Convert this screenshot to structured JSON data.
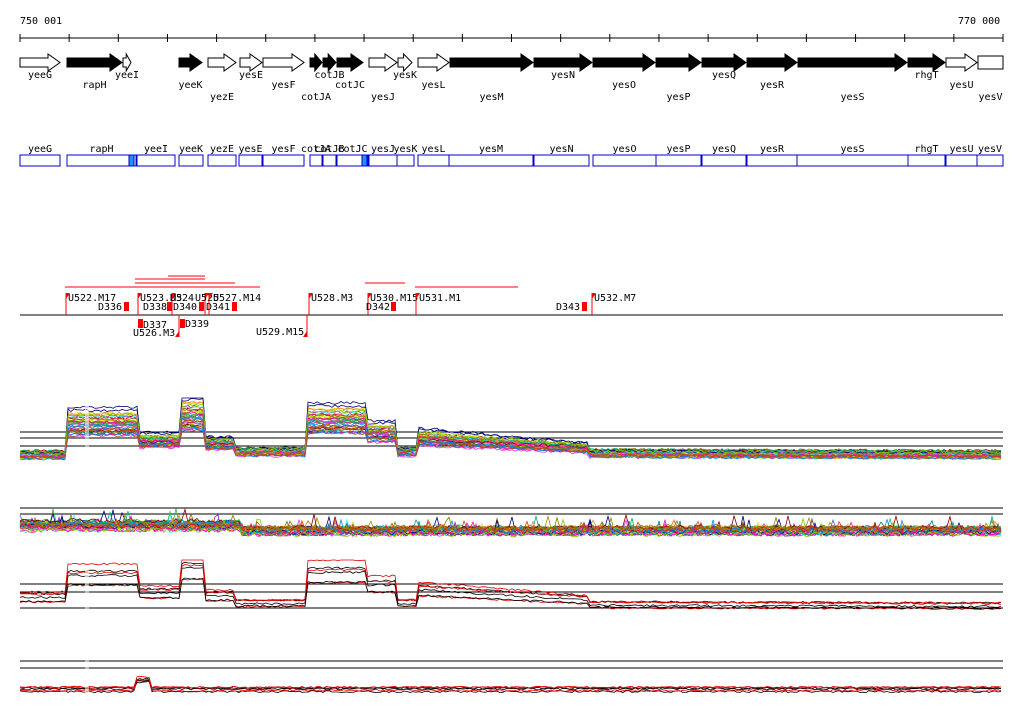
{
  "ruler": {
    "start_label": "750 001",
    "end_label": "770 000"
  },
  "genes": [
    {
      "name": "yeeG",
      "strand": "+",
      "fill": "white",
      "label_row": 1
    },
    {
      "name": "rapH",
      "strand": "+",
      "fill": "black",
      "label_row": 2
    },
    {
      "name": "yeeI",
      "strand": "+",
      "fill": "white",
      "label_row": 1
    },
    {
      "name": "yeeK",
      "strand": "+",
      "fill": "black",
      "label_row": 2
    },
    {
      "name": "yezE",
      "strand": "+",
      "fill": "white",
      "label_row": 3
    },
    {
      "name": "yesE",
      "strand": "+",
      "fill": "white",
      "label_row": 1
    },
    {
      "name": "yesF",
      "strand": "+",
      "fill": "white",
      "label_row": 2
    },
    {
      "name": "cotJA",
      "strand": "+",
      "fill": "black",
      "label_row": 3
    },
    {
      "name": "cotJB",
      "strand": "+",
      "fill": "black",
      "label_row": 1
    },
    {
      "name": "cotJC",
      "strand": "+",
      "fill": "black",
      "label_row": 2
    },
    {
      "name": "yesJ",
      "strand": "+",
      "fill": "white",
      "label_row": 3
    },
    {
      "name": "yesK",
      "strand": "+",
      "fill": "white",
      "label_row": 1
    },
    {
      "name": "yesL",
      "strand": "+",
      "fill": "white",
      "label_row": 2
    },
    {
      "name": "yesM",
      "strand": "+",
      "fill": "black",
      "label_row": 3
    },
    {
      "name": "yesN",
      "strand": "+",
      "fill": "black",
      "label_row": 1
    },
    {
      "name": "yesO",
      "strand": "+",
      "fill": "black",
      "label_row": 2
    },
    {
      "name": "yesP",
      "strand": "+",
      "fill": "black",
      "label_row": 3
    },
    {
      "name": "yesQ",
      "strand": "+",
      "fill": "black",
      "label_row": 1
    },
    {
      "name": "yesR",
      "strand": "+",
      "fill": "black",
      "label_row": 2
    },
    {
      "name": "yesS",
      "strand": "+",
      "fill": "black",
      "label_row": 3
    },
    {
      "name": "rhgT",
      "strand": "+",
      "fill": "black",
      "label_row": 1
    },
    {
      "name": "yesU",
      "strand": "+",
      "fill": "white",
      "label_row": 2
    },
    {
      "name": "yesV",
      "strand": "+",
      "fill": "white",
      "label_row": 3
    }
  ],
  "gene_boxes": [
    "yeeG",
    "rapH",
    "yeeI",
    "yeeK",
    "yezE",
    "yesE",
    "yesF",
    "cotJA",
    "cotJB",
    "cotJC",
    "yesJ",
    "yesK",
    "yesL",
    "yesM",
    "yesN",
    "yesO",
    "yesP",
    "yesQ",
    "yesR",
    "yesS",
    "rhgT",
    "yesU",
    "yesV"
  ],
  "gene_box_labels": [
    "yeeG",
    "rapH",
    "yeeI",
    "yeeK",
    "yezE",
    "yesE",
    "yesF",
    "cotJA",
    "cotJB",
    "cotJC",
    "yesJ",
    "yesK",
    "yesL",
    "yesM",
    "yesN",
    "yesO",
    "yesP",
    "yesQ",
    "yesR",
    "yesS",
    "rhgT",
    "yesU",
    "yesV"
  ],
  "segments_above": [
    {
      "label": "U522.M17"
    },
    {
      "label": "D336"
    },
    {
      "label": "U523.M3"
    },
    {
      "label": "D338"
    },
    {
      "label": "U524"
    },
    {
      "label": "D340"
    },
    {
      "label": "U525"
    },
    {
      "label": "U527.M14"
    },
    {
      "label": "D341"
    },
    {
      "label": "U528.M3"
    },
    {
      "label": "U530.M15"
    },
    {
      "label": "D342"
    },
    {
      "label": "U531.M1"
    },
    {
      "label": "D343"
    },
    {
      "label": "U532.M7"
    }
  ],
  "segments_below": [
    {
      "label": "D337"
    },
    {
      "label": "U526.M3"
    },
    {
      "label": "D339"
    },
    {
      "label": "U529.M15"
    }
  ],
  "colors": {
    "box_border": "#0000cc",
    "box_highlight": "#1e90ff",
    "marker": "#ff0000",
    "profile_black": "#000000",
    "profile_red": "#e00000"
  },
  "panels": [
    {
      "name": "expression-profiles-upper",
      "type": "multi-color lines"
    },
    {
      "name": "expression-profiles-lower",
      "type": "multi-color lines"
    },
    {
      "name": "mean-profiles-upper",
      "type": "black and red lines"
    },
    {
      "name": "mean-profiles-lower",
      "type": "black and red lines"
    }
  ]
}
